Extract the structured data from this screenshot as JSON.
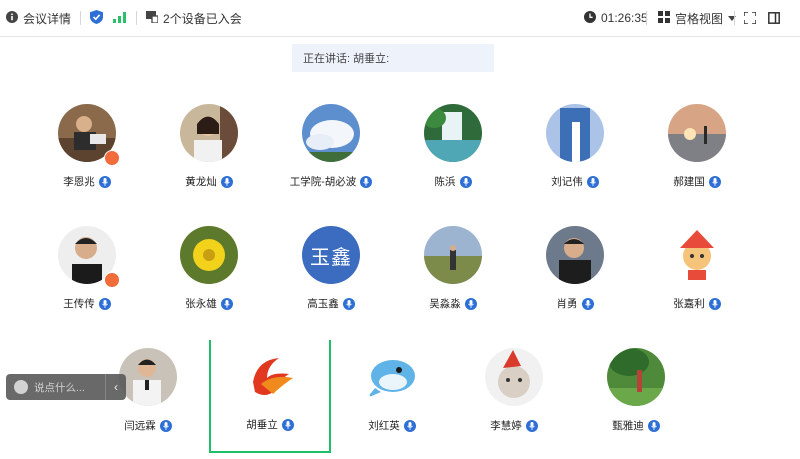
{
  "topbar": {
    "meeting_info": "会议详情",
    "devices_joined": "2个设备已入会",
    "timer": "01:26:35",
    "view_mode": "宫格视图"
  },
  "speaking": "正在讲话: 胡垂立:",
  "chat": {
    "placeholder": "说点什么..."
  },
  "participants": [
    {
      "name": "李恩兆"
    },
    {
      "name": "黄龙灿"
    },
    {
      "name": "工学院-胡必波"
    },
    {
      "name": "陈浜"
    },
    {
      "name": "刘记伟"
    },
    {
      "name": "郝建国"
    },
    {
      "name": "王传传"
    },
    {
      "name": "张永雄"
    },
    {
      "name": "高玉鑫",
      "avatar_text": "玉鑫"
    },
    {
      "name": "吴淼淼"
    },
    {
      "name": "肖勇"
    },
    {
      "name": "张嘉利"
    },
    {
      "name": "闫远霖"
    },
    {
      "name": "胡垂立"
    },
    {
      "name": "刘红英"
    },
    {
      "name": "李慧婷"
    },
    {
      "name": "甄雅迪"
    }
  ],
  "colors": {
    "accent": "#2d6fd6",
    "active_border": "#1fbf6a",
    "badge": "#f26b3a"
  }
}
